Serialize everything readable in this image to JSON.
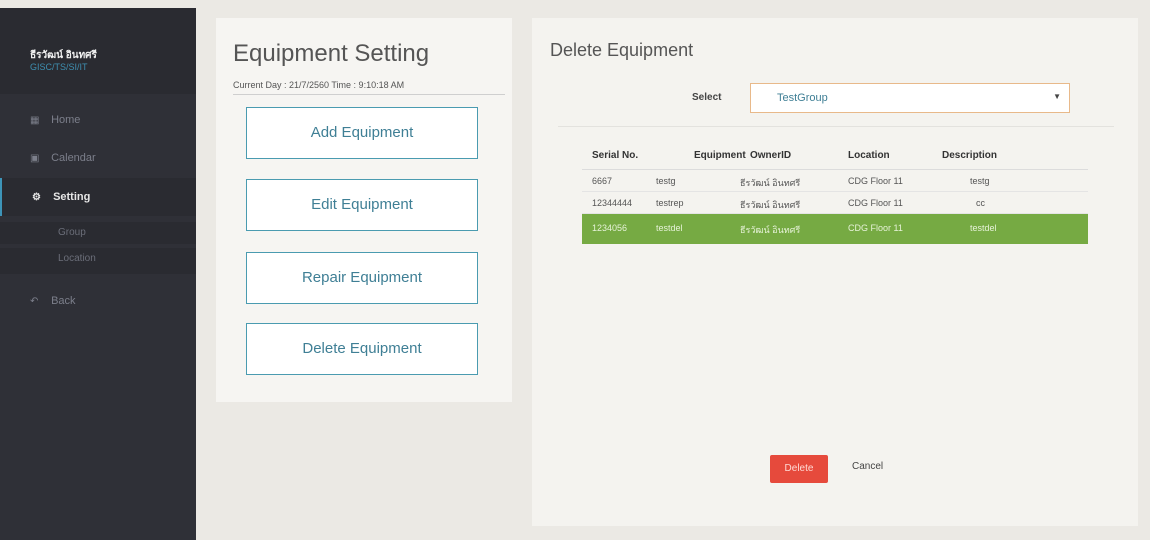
{
  "sidebar": {
    "user_name": "ธีรวัฒน์ อินทศรี",
    "user_org": "GISC/TS/SI/IT",
    "items": [
      {
        "label": "Home",
        "icon": "grid-icon"
      },
      {
        "label": "Calendar",
        "icon": "calendar-icon"
      },
      {
        "label": "Setting",
        "icon": "gear-icon"
      },
      {
        "label": "Back",
        "icon": "back-arrow-icon"
      }
    ],
    "subitems": [
      {
        "label": "Group"
      },
      {
        "label": "Location"
      }
    ]
  },
  "left_panel": {
    "title": "Equipment Setting",
    "current_time": "Current  Day :  21/7/2560  Time :  9:10:18 AM",
    "buttons": {
      "add": "Add Equipment",
      "edit": "Edit Equipment",
      "repair": "Repair Equipment",
      "delete": "Delete Equipment"
    }
  },
  "right_panel": {
    "title": "Delete Equipment",
    "select_label": "Select",
    "select_value": "TestGroup",
    "table": {
      "headers": [
        "Serial No.",
        "Equipment",
        "OwnerID",
        "Location",
        "Description"
      ],
      "rows": [
        [
          "6667",
          "testg",
          "ธีรวัฒน์ อินทศรี",
          "CDG Floor 11",
          "testg"
        ],
        [
          "12344444",
          "testrep",
          "ธีรวัฒน์ อินทศรี",
          "CDG Floor 11",
          "cc"
        ],
        [
          "1234056",
          "testdel",
          "ธีรวัฒน์ อินทศรี",
          "CDG Floor 11",
          "testdel"
        ]
      ],
      "selected_row": 2
    },
    "delete_label": "Delete",
    "cancel_label": "Cancel"
  },
  "colors": {
    "sidebar_bg": "#2f3037",
    "accent": "#3f7f95",
    "selected_row": "#76aa43",
    "delete_button": "#e64a3c"
  }
}
